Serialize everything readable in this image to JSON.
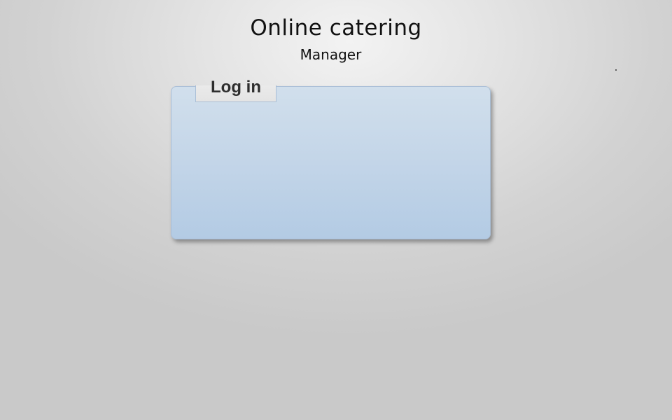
{
  "header": {
    "title": "Online catering",
    "subtitle": "Manager"
  },
  "login_panel": {
    "tab_label": "Log in"
  }
}
